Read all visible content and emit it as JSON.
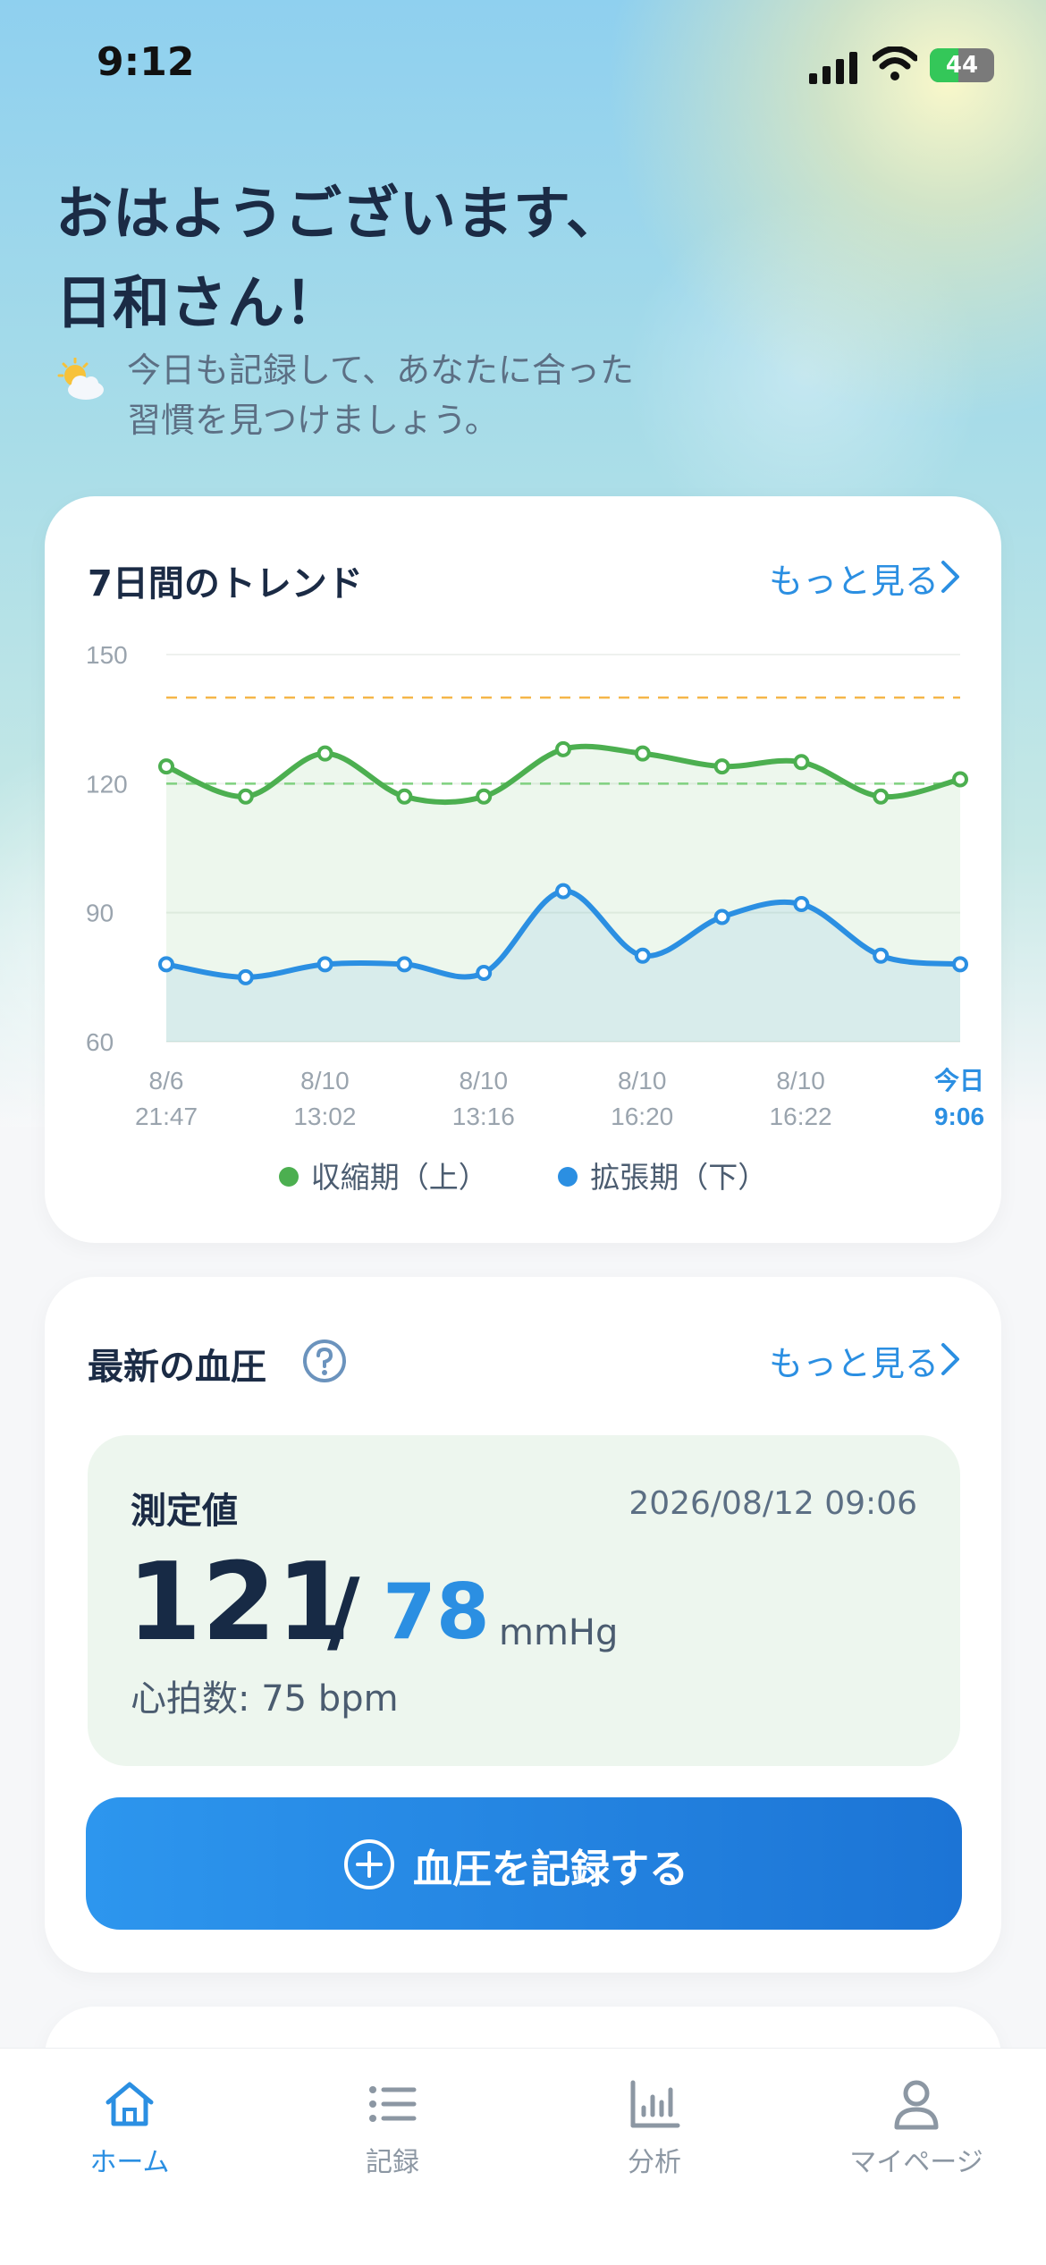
{
  "status_bar": {
    "time": "9:12",
    "battery": "44",
    "battery_level": 0.44
  },
  "greeting": {
    "title_line1": "おはようございます、",
    "title_line2": "日和さん！",
    "subtitle_line1": "今日も記録して、あなたに合った",
    "subtitle_line2": "習慣を見つけましょう。",
    "weather_icon": "partly-sunny-icon"
  },
  "trend_card": {
    "title": "7日間のトレンド",
    "more_label": "もっと見る",
    "chart_data": {
      "type": "line",
      "ylim": [
        60,
        150
      ],
      "yticks": [
        "150",
        "120",
        "90",
        "60"
      ],
      "x_labels": [
        {
          "line1": "8/6",
          "line2": "21:47"
        },
        {
          "line1": "8/10",
          "line2": "13:02"
        },
        {
          "line1": "8/10",
          "line2": "13:16"
        },
        {
          "line1": "8/10",
          "line2": "16:20"
        },
        {
          "line1": "8/10",
          "line2": "16:22"
        },
        {
          "line1": "今日",
          "line2": "9:06"
        }
      ],
      "reference_lines": [
        {
          "value": 140,
          "color": "#f5b64a"
        },
        {
          "value": 120,
          "color": "#7fd07f"
        }
      ],
      "series": [
        {
          "name": "収縮期（上）",
          "color": "#4caf50",
          "values": [
            124,
            117,
            127,
            117,
            117,
            128,
            127,
            124,
            125,
            117,
            121
          ]
        },
        {
          "name": "拡張期（下）",
          "color": "#2b8fe2",
          "values": [
            78,
            75,
            78,
            78,
            76,
            95,
            80,
            89,
            92,
            80,
            78
          ]
        }
      ]
    }
  },
  "latest_card": {
    "title": "最新の血圧",
    "help_icon": "question-circle-icon",
    "more_label": "もっと見る",
    "measurement": {
      "label": "測定値",
      "datetime": "2026/08/12 09:06",
      "systolic": "121",
      "slash": "/",
      "diastolic": "78",
      "unit": "mmHg",
      "heart_rate": "心拍数: 75 bpm"
    },
    "record_button": "血圧を記録する"
  },
  "tabs": [
    {
      "label": "ホーム",
      "icon": "home-icon",
      "active": true
    },
    {
      "label": "記録",
      "icon": "list-icon",
      "active": false
    },
    {
      "label": "分析",
      "icon": "bar-chart-icon",
      "active": false
    },
    {
      "label": "マイページ",
      "icon": "person-icon",
      "active": false
    }
  ],
  "colors": {
    "accent": "#2b8fe2",
    "systolic": "#4caf50",
    "inactive_tab": "#8c97a3"
  }
}
